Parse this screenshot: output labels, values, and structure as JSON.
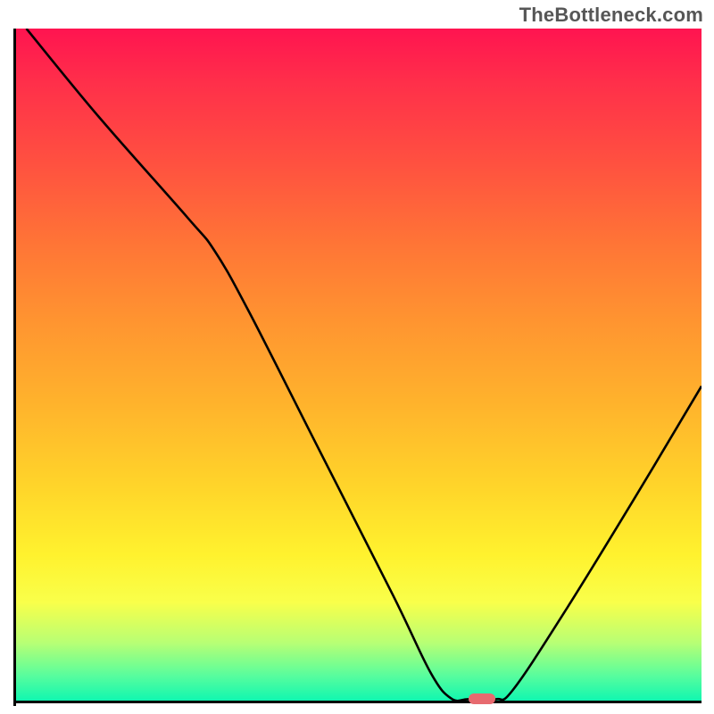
{
  "watermark": "TheBottleneck.com",
  "colors": {
    "gradient_top": "#ff1450",
    "gradient_mid": "#ffd52a",
    "gradient_bottom": "#09f6b2",
    "axis": "#000000",
    "curve": "#000000",
    "marker": "#e76a6f"
  },
  "chart_data": {
    "type": "line",
    "title": "",
    "xlabel": "",
    "ylabel": "",
    "xlim": [
      0,
      100
    ],
    "ylim": [
      0,
      100
    ],
    "grid": false,
    "curve_xy": [
      [
        1.5,
        100.0
      ],
      [
        12.0,
        87.0
      ],
      [
        25.0,
        72.0
      ],
      [
        29.0,
        67.0
      ],
      [
        34.0,
        58.0
      ],
      [
        44.0,
        38.0
      ],
      [
        55.0,
        16.0
      ],
      [
        60.5,
        4.5
      ],
      [
        63.5,
        0.7
      ],
      [
        66.0,
        0.6
      ],
      [
        70.0,
        0.6
      ],
      [
        72.5,
        2.0
      ],
      [
        80.0,
        13.5
      ],
      [
        90.0,
        30.0
      ],
      [
        100.0,
        47.0
      ]
    ],
    "marker": {
      "x": 68.0,
      "y": 0.6
    },
    "note": "x and y given as percentages of the plotting area; y=0 is at the bottom axis, y=100 at the top"
  }
}
